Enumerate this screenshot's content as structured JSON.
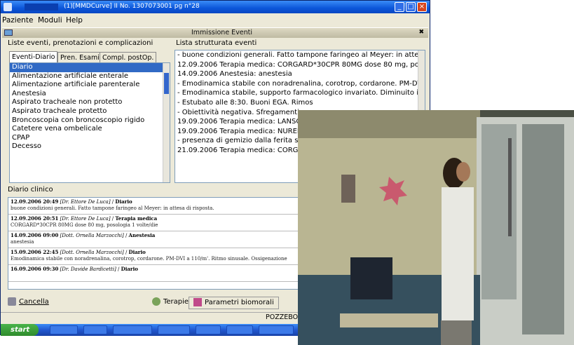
{
  "window": {
    "title": "(1)[MMDCurve] II No. 1307073001 pg n°28",
    "accent": "#0b55d9"
  },
  "menubar": [
    "Paziente",
    "Moduli",
    "Help"
  ],
  "toolbar": {
    "title": "Immissione Eventi"
  },
  "left_panel": {
    "header": "Liste eventi, prenotazioni e complicazioni",
    "tabs": [
      "Eventi-Diario",
      "Pren. Esami",
      "Compl. postOp."
    ],
    "items": [
      "Diario",
      "Alimentazione artificiale enterale",
      "Alimentazione artificiale parenterale",
      "Anestesia",
      "Aspirato tracheale non protetto",
      "Aspirato tracheale protetto",
      "Broncoscopia con broncoscopio rigido",
      "Catetere vena ombelicale",
      "CPAP",
      "Decesso"
    ],
    "selected": 0
  },
  "right_panel": {
    "header": "Lista strutturata eventi",
    "rows": [
      "- buone condizioni generali. Fatto tampone faringeo al Meyer: in attesa di",
      "12.09.2006 Terapia medica: CORGARD*30CPR 80MG dose 80 mg, posolo",
      "14.09.2006 Anestesia: anestesia",
      "- Emodinamica stabile con noradrenalina, corotrop, cordarone.  PM-DVI a",
      "- Emodinamica stabile, supporto farmacologico invariato. Diminuito il dr",
      "- Estubato alle 8:30. Buoni EGA. Rimos",
      "- Obiettività negativa. Sfregamenti pe",
      "19.09.2006 Terapia medica: LANSOX",
      "19.09.2006 Terapia medica: NUREFL",
      "- presenza di gemizio dalla ferita ster",
      "21.09.2006 Terapia medica: CORGAR"
    ]
  },
  "diary": {
    "header": "Diario clinico",
    "entries": [
      {
        "date": "12.09.2006 20:49",
        "author": "[Dr. Ettore De Luca]",
        "category": "Diario",
        "text": "buone condizioni generali. Fatto tampone faringeo al Meyer: in attesa di risposta."
      },
      {
        "date": "12.09.2006 20:51",
        "author": "[Dr. Ettore De Luca]",
        "category": "Terapia medica",
        "text": "CORGARD*30CPR 80MG dose 80 mg, posologia 1 volte/die"
      },
      {
        "date": "14.09.2006 09:00",
        "author": "[Dott. Ornella Marzocchi]",
        "category": "Anestesia",
        "text": "anestesia"
      },
      {
        "date": "15.09.2006 22:45",
        "author": "[Dott. Ornella Marzocchi]",
        "category": "Diario",
        "text": "Emodinamica stabile con noradrenalina, corotrop, cordarone. PM-DVI a 110/m'. Ritmo sinusale. Ossigenazione"
      },
      {
        "date": "16.09.2006 09:30",
        "author": "[Dr. Davide Bardicetti]",
        "category": "Diario",
        "text": ""
      }
    ]
  },
  "buttons": {
    "cancel": "Cancella",
    "therapy": "Terapie",
    "params": "Parametri biomorali"
  },
  "status": {
    "user": "POZZEBO"
  },
  "taskbar": {
    "start": "start"
  }
}
